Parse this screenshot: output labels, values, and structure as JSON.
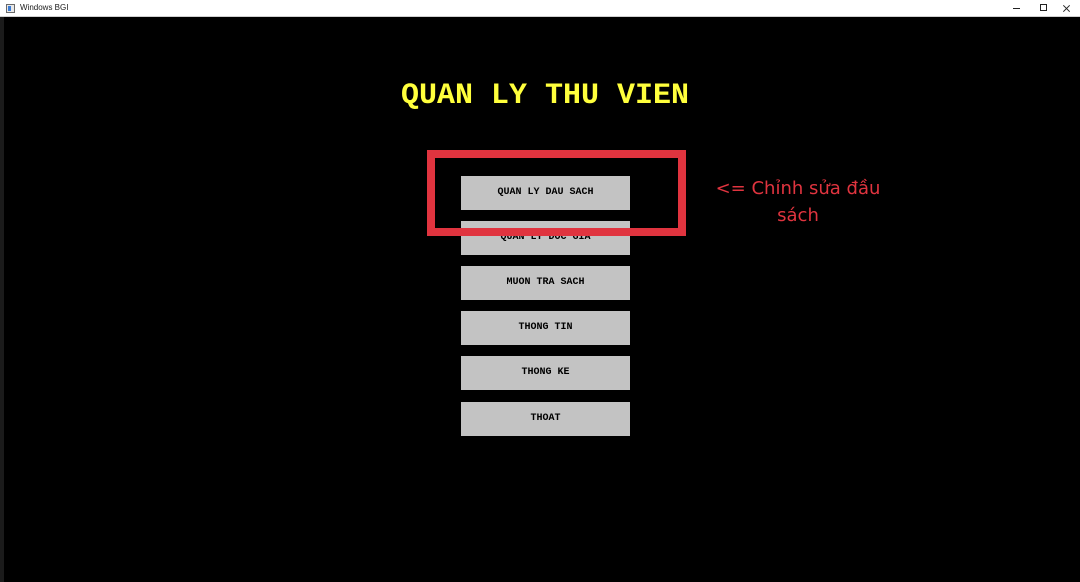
{
  "window": {
    "title": "Windows BGI"
  },
  "screen": {
    "title": "QUAN LY THU VIEN",
    "menu": [
      {
        "label": "QUAN LY DAU SACH"
      },
      {
        "label": "QUAN LY DOC GIA"
      },
      {
        "label": "MUON TRA SACH"
      },
      {
        "label": "THONG TIN"
      },
      {
        "label": "THONG KE"
      },
      {
        "label": "THOAT"
      }
    ]
  },
  "annotation": {
    "line1": "<= Chỉnh sửa đầu",
    "line2": "sách"
  },
  "colors": {
    "background": "#000000",
    "title": "#ffff3c",
    "button": "#c3c3c3",
    "highlight": "#e0343f"
  },
  "icons": {
    "app": "bgi-window-icon",
    "minimize": "minimize-icon",
    "maximize": "maximize-icon",
    "close": "close-icon"
  }
}
